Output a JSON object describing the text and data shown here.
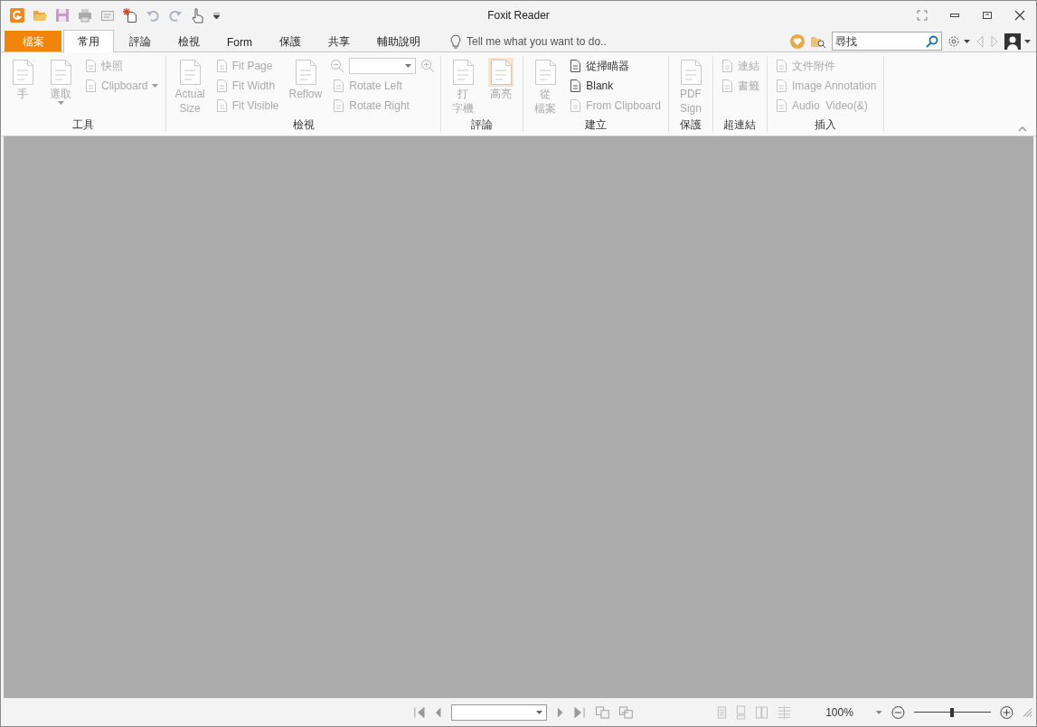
{
  "window": {
    "title": "Foxit Reader"
  },
  "quick_access": [
    {
      "kind": "logo"
    },
    {
      "kind": "open"
    },
    {
      "kind": "save"
    },
    {
      "kind": "print"
    },
    {
      "kind": "mail"
    },
    {
      "kind": "new"
    },
    {
      "kind": "undo"
    },
    {
      "kind": "redo"
    },
    {
      "kind": "hand"
    },
    {
      "kind": "customize"
    }
  ],
  "tabs": [
    {
      "label": "檔案",
      "kind": "file",
      "selected": false
    },
    {
      "label": "常用",
      "kind": "tab",
      "selected": true
    },
    {
      "label": "評論",
      "kind": "tab",
      "selected": false
    },
    {
      "label": "檢視",
      "kind": "tab",
      "selected": false
    },
    {
      "label": "Form",
      "kind": "tab",
      "selected": false
    },
    {
      "label": "保護",
      "kind": "tab",
      "selected": false
    },
    {
      "label": "共享",
      "kind": "tab",
      "selected": false
    },
    {
      "label": "輔助說明",
      "kind": "tab",
      "selected": false
    }
  ],
  "tell_me": {
    "placeholder": "Tell me what you want to do.."
  },
  "search": {
    "placeholder": "尋找"
  },
  "ribbon_groups": [
    {
      "label": "工具",
      "items": [
        {
          "kind": "large",
          "lines": [
            "手"
          ],
          "disabled": true,
          "selected": false,
          "dropdown": false
        },
        {
          "kind": "large",
          "lines": [
            "選取"
          ],
          "disabled": true,
          "selected": false,
          "dropdown": true
        },
        {
          "kind": "small",
          "label": "快照",
          "disabled": true,
          "dropdown": false
        },
        {
          "kind": "small",
          "label": "Clipboard",
          "disabled": true,
          "dropdown": true
        }
      ]
    },
    {
      "label": "檢視",
      "items": [
        {
          "kind": "large",
          "lines": [
            "Actual",
            "Size"
          ],
          "disabled": true,
          "selected": false,
          "dropdown": false
        },
        {
          "kind": "small",
          "label": "Fit Page",
          "disabled": true,
          "dropdown": false
        },
        {
          "kind": "small",
          "label": "Fit Width",
          "disabled": true,
          "dropdown": false
        },
        {
          "kind": "small",
          "label": "Fit Visible",
          "disabled": true,
          "dropdown": false
        },
        {
          "kind": "large",
          "lines": [
            "Reflow"
          ],
          "disabled": true,
          "selected": false,
          "dropdown": false
        },
        {
          "kind": "zoom",
          "disabled": true
        },
        {
          "kind": "small",
          "label": "Rotate Left",
          "disabled": true,
          "dropdown": false
        },
        {
          "kind": "small",
          "label": "Rotate Right",
          "disabled": true,
          "dropdown": false
        }
      ]
    },
    {
      "label": "評論",
      "items": [
        {
          "kind": "large",
          "lines": [
            "打",
            "字機"
          ],
          "disabled": true,
          "selected": false,
          "dropdown": false
        },
        {
          "kind": "large",
          "lines": [
            "高亮"
          ],
          "disabled": true,
          "selected": true,
          "dropdown": false
        }
      ]
    },
    {
      "label": "建立",
      "items": [
        {
          "kind": "large",
          "lines": [
            "從",
            "檔案"
          ],
          "disabled": true,
          "selected": false,
          "dropdown": false
        },
        {
          "kind": "small",
          "label": "從掃瞄器",
          "disabled": false,
          "dropdown": false
        },
        {
          "kind": "small",
          "label": "Blank",
          "disabled": false,
          "dropdown": false
        },
        {
          "kind": "small",
          "label": "From Clipboard",
          "disabled": true,
          "dropdown": false
        }
      ]
    },
    {
      "label": "保護",
      "items": [
        {
          "kind": "large",
          "lines": [
            "PDF",
            "Sign"
          ],
          "disabled": true,
          "selected": false,
          "dropdown": false
        }
      ]
    },
    {
      "label": "超連結",
      "items": [
        {
          "kind": "small",
          "label": "連結",
          "disabled": true,
          "dropdown": false
        },
        {
          "kind": "small",
          "label": "書籤",
          "disabled": true,
          "dropdown": false
        }
      ]
    },
    {
      "label": "插入",
      "items": [
        {
          "kind": "small",
          "label": "文件附件",
          "disabled": true,
          "dropdown": false
        },
        {
          "kind": "small",
          "label": "Image Annotation",
          "disabled": true,
          "dropdown": false
        },
        {
          "kind": "small",
          "label": "Audio  Video(&)",
          "disabled": true,
          "dropdown": false
        }
      ]
    }
  ],
  "status_bar": {
    "zoom": "100%",
    "zoom_slider": {
      "level": 0.5
    }
  }
}
